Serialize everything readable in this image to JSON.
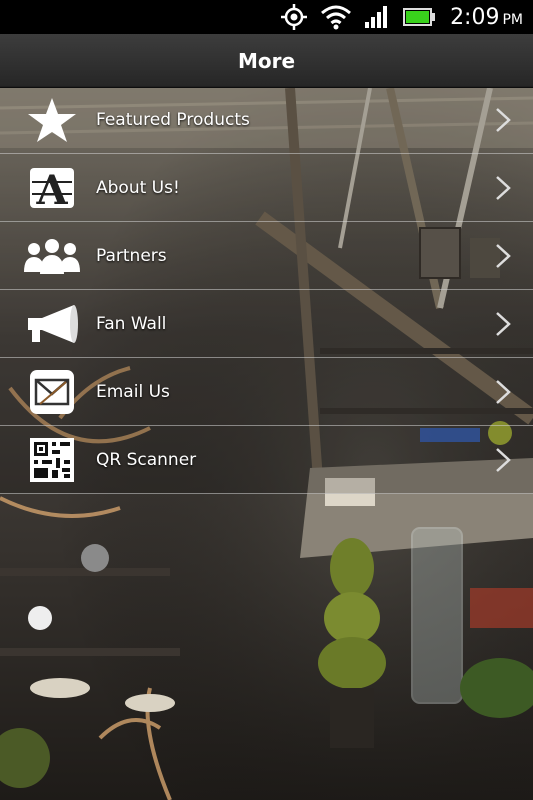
{
  "status_bar": {
    "time": "2:09",
    "ampm": "PM",
    "icons": [
      "gps-icon",
      "wifi-icon",
      "signal-icon",
      "battery-icon"
    ]
  },
  "header": {
    "title": "More"
  },
  "menu": {
    "items": [
      {
        "label": "Featured Products",
        "icon": "star-icon"
      },
      {
        "label": "About Us!",
        "icon": "letter-a-icon"
      },
      {
        "label": "Partners",
        "icon": "people-icon"
      },
      {
        "label": "Fan Wall",
        "icon": "megaphone-icon"
      },
      {
        "label": "Email Us",
        "icon": "envelope-icon"
      },
      {
        "label": "QR Scanner",
        "icon": "qr-code-icon"
      }
    ]
  },
  "colors": {
    "battery": "#39d21c",
    "statusbar": "#000000",
    "titlebar": "#333333"
  }
}
